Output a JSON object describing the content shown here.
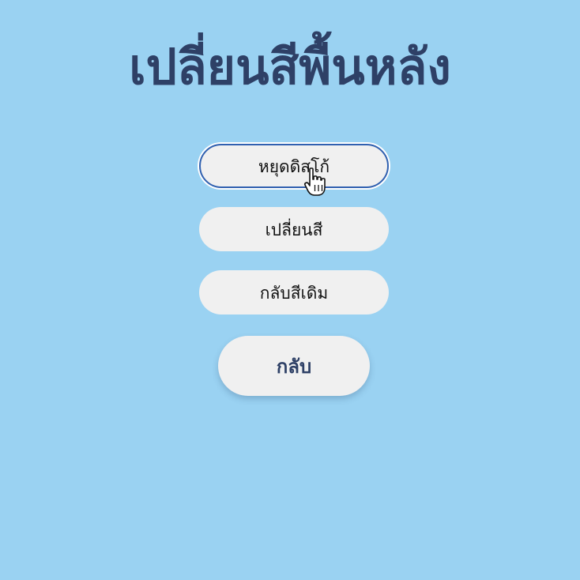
{
  "page": {
    "title": "เปลี่ยนสีพื้นหลัง"
  },
  "buttons": {
    "stop_disco": "หยุดดิสโก้",
    "change_color": "เปลี่ยนสี",
    "restore_color": "กลับสีเดิม",
    "back": "กลับ"
  },
  "colors": {
    "background": "#9ad2f2",
    "title": "#2e4066",
    "button_bg": "#f0f0f0",
    "focus_ring": "#2f60b0"
  },
  "icons": {
    "cursor": "hand-pointer-icon"
  }
}
